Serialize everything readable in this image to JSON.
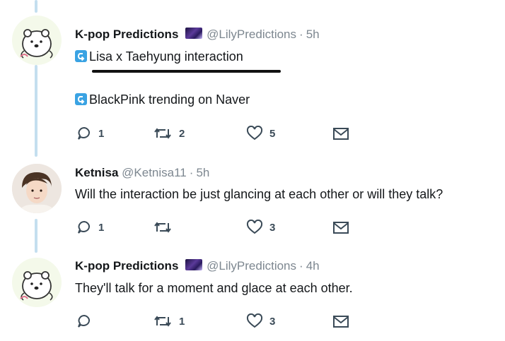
{
  "tweets": [
    {
      "name": "K-pop Predictions",
      "handle": "@LilyPredictions",
      "time": "5h",
      "lines": [
        "Lisa x Taehyung interaction",
        "BlackPink trending on Naver"
      ],
      "counts": {
        "reply": "1",
        "retweet": "2",
        "like": "5"
      }
    },
    {
      "name": "Ketnisa",
      "handle": "@Ketnisa11",
      "time": "5h",
      "text": "Will the interaction be just glancing at each other or will they talk?",
      "counts": {
        "reply": "1",
        "retweet": "",
        "like": "3"
      }
    },
    {
      "name": "K-pop Predictions",
      "handle": "@LilyPredictions",
      "time": "4h",
      "text": "They'll talk for a moment and glace at each other.",
      "counts": {
        "reply": "",
        "retweet": "1",
        "like": "3"
      }
    }
  ],
  "icons": {
    "link": "link-icon",
    "reply": "reply-icon",
    "retweet": "retweet-icon",
    "like": "heart-icon",
    "dm": "envelope-icon",
    "emoji": "galaxy-emoji"
  },
  "colors": {
    "thread_line": "#c4dfef",
    "link_badge": "#3aa3e3",
    "muted": "#7d8790"
  }
}
